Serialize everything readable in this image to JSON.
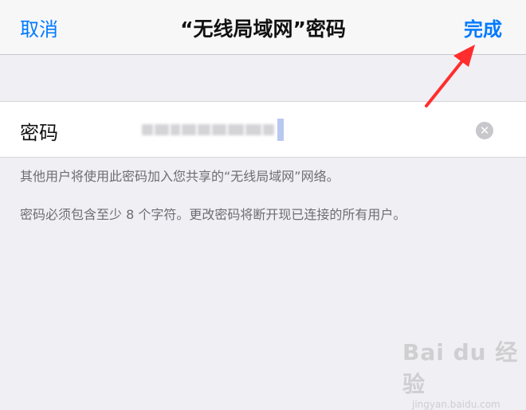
{
  "navbar": {
    "cancel_label": "取消",
    "title": "“无线局域网”密码",
    "done_label": "完成"
  },
  "password_cell": {
    "label": "密码",
    "value_masked": true
  },
  "footnotes": [
    "其他用户将使用此密码加入您共享的“无线局域网”网络。",
    "密码必须包含至少 8 个字符。更改密码将断开现已连接的所有用户。"
  ],
  "watermark": {
    "brand": "Bai du 经验",
    "url": "jingyan.baidu.com"
  },
  "colors": {
    "accent": "#007aff",
    "annotation_arrow": "#ff2d2d",
    "background": "#efeff4"
  }
}
